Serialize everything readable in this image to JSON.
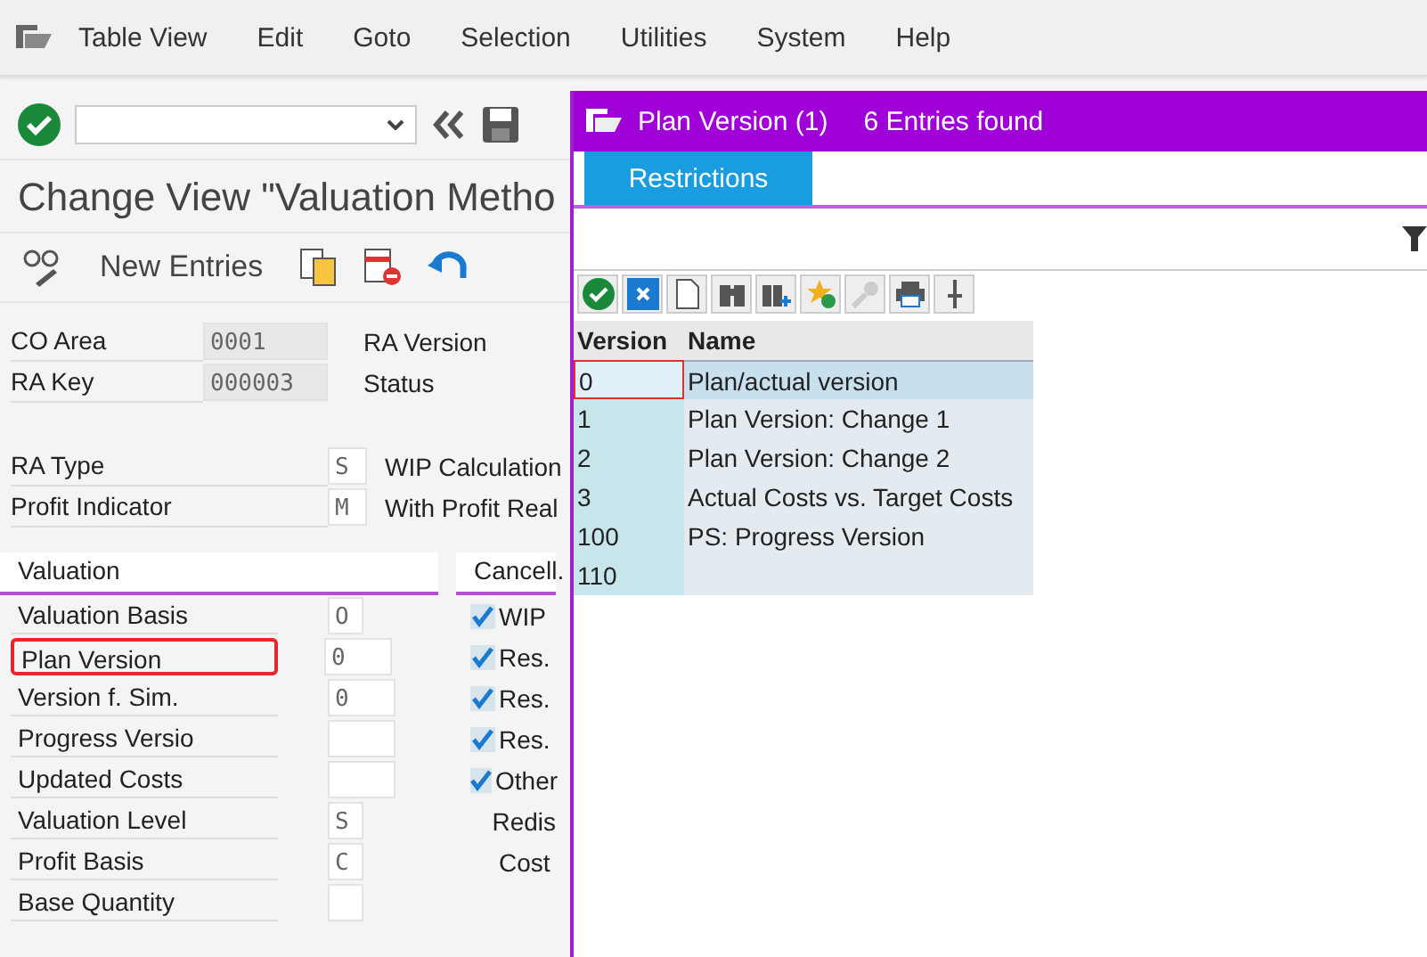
{
  "menu_bar": {
    "items": [
      "Table View",
      "Edit",
      "Goto",
      "Selection",
      "Utilities",
      "System",
      "Help"
    ]
  },
  "title": "Change View \"Valuation Metho",
  "app_toolbar": {
    "new_entries": "New Entries"
  },
  "header_fields": [
    {
      "label": "CO Area",
      "value": "0001",
      "right_label": "RA Version"
    },
    {
      "label": "RA Key",
      "value": "000003",
      "right_label": "Status"
    }
  ],
  "type_fields": [
    {
      "label": "RA Type",
      "value": "S",
      "text": "WIP Calculation"
    },
    {
      "label": "Profit Indicator",
      "value": "M",
      "text": "With Profit Real"
    }
  ],
  "valuation": {
    "title": "Valuation",
    "fields": [
      {
        "label": "Valuation Basis",
        "value": "O",
        "kind": "short",
        "highlighted": false
      },
      {
        "label": "Plan Version",
        "value": "0",
        "kind": "wide",
        "highlighted": true
      },
      {
        "label": "Version f. Sim.",
        "value": "0",
        "kind": "wide",
        "highlighted": false
      },
      {
        "label": "Progress Versio",
        "kind": "wide",
        "highlighted": false
      },
      {
        "label": "Updated Costs",
        "kind": "wide",
        "highlighted": false
      },
      {
        "label": "Valuation Level",
        "value": "S",
        "kind": "short",
        "highlighted": false
      },
      {
        "label": "Profit Basis",
        "value": "C",
        "kind": "short",
        "highlighted": false
      },
      {
        "label": "Base Quantity",
        "kind": "short",
        "highlighted": false
      }
    ]
  },
  "cancellation": {
    "title": "Cancell.",
    "items": [
      {
        "label": "WIP",
        "kind": "checkbox",
        "checked": true
      },
      {
        "label": "Res.",
        "kind": "checkbox",
        "checked": true
      },
      {
        "label": "Res.",
        "kind": "checkbox",
        "checked": true
      },
      {
        "label": "Res.",
        "kind": "checkbox",
        "checked": true
      },
      {
        "label": "Other",
        "kind": "checkbox",
        "checked": true
      },
      {
        "label": "Redis",
        "kind": "text"
      },
      {
        "label": "Cost",
        "kind": "text"
      }
    ]
  },
  "popup": {
    "title": "Plan Version (1)",
    "count": "6 Entries found",
    "tabs": [
      {
        "label": "Restrictions",
        "selected": true
      }
    ],
    "table": {
      "columns": [
        "Version",
        "Name"
      ],
      "rows": [
        {
          "version": "0",
          "name": "Plan/actual version",
          "selected": true
        },
        {
          "version": "1",
          "name": "Plan Version: Change 1",
          "selected": false
        },
        {
          "version": "2",
          "name": "Plan Version: Change 2",
          "selected": false
        },
        {
          "version": "3",
          "name": "Actual Costs vs. Target Costs",
          "selected": false
        },
        {
          "version": "100",
          "name": "PS: Progress Version",
          "selected": false
        },
        {
          "version": "110",
          "selected": false
        }
      ]
    }
  }
}
